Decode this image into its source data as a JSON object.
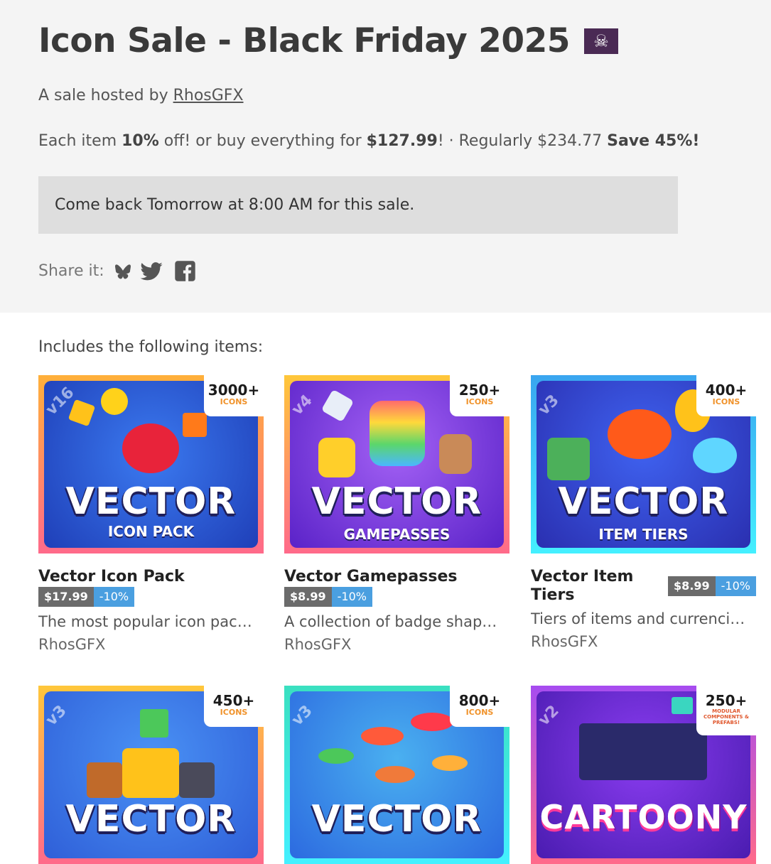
{
  "header": {
    "title": "Icon Sale - Black Friday 2025",
    "flag_glyph": "☠",
    "host_prefix": "A sale hosted by ",
    "host_name": "RhosGFX",
    "pricing": {
      "p1": "Each item ",
      "p2": "10%",
      "p3": " off! or buy everything for ",
      "p4": "$127.99",
      "p5": "! · Regularly $234.77 ",
      "p6": "Save 45%!"
    },
    "notice": "Come back Tomorrow at 8:00 AM for this sale.",
    "share_label": "Share it:",
    "share_icons": [
      "bluesky-icon",
      "twitter-icon",
      "facebook-icon"
    ]
  },
  "includes_label": "Includes the following items:",
  "items": [
    {
      "title": "Vector Icon Pack",
      "price": "$17.99",
      "discount": "-10%",
      "description": "The most popular icon pack …",
      "author": "RhosGFX",
      "badge_count": "3000+",
      "badge_sub": "ICONS",
      "version": "v16",
      "logo": "VECTOR",
      "logo_sub": "ICON PACK",
      "colors": {
        "bg": "#1f4fd6",
        "frame": "#ffb03a",
        "frame2": "#ff6a8a"
      }
    },
    {
      "title": "Vector Gamepasses",
      "price": "$8.99",
      "discount": "-10%",
      "description": "A collection of badge shapes…",
      "author": "RhosGFX",
      "badge_count": "250+",
      "badge_sub": "ICONS",
      "version": "v4",
      "logo": "VECTOR",
      "logo_sub": "GAMEPASSES",
      "colors": {
        "bg": "#7a3ce0",
        "frame": "#ffc73a",
        "frame2": "#ff6a8a"
      }
    },
    {
      "title": "Vector Item Tiers",
      "price": "$8.99",
      "discount": "-10%",
      "description": "Tiers of items and currencie…",
      "author": "RhosGFX",
      "badge_count": "400+",
      "badge_sub": "ICONS",
      "version": "v3",
      "logo": "VECTOR",
      "logo_sub": "ITEM TIERS",
      "colors": {
        "bg": "#2a3fd8",
        "frame": "#3aa5f0",
        "frame2": "#44f0ff"
      }
    },
    {
      "badge_count": "450+",
      "badge_sub": "ICONS",
      "version": "v3",
      "logo": "VECTOR",
      "colors": {
        "bg": "#2f7be8",
        "frame": "#ffc73a",
        "frame2": "#ff6a8a"
      }
    },
    {
      "badge_count": "800+",
      "badge_sub": "ICONS",
      "version": "v3",
      "logo": "VECTOR",
      "colors": {
        "bg": "#2c86e0",
        "frame": "#3ae0c0",
        "frame2": "#44f0ff"
      }
    },
    {
      "badge_count": "250+",
      "badge_sub": "MODULAR COMPONENTS & PREFABS!",
      "version": "v2",
      "logo": "CARTOONY",
      "colors": {
        "bg": "#7a2fe0",
        "frame": "#a64cf0",
        "frame2": "#ff6a8a"
      }
    }
  ]
}
